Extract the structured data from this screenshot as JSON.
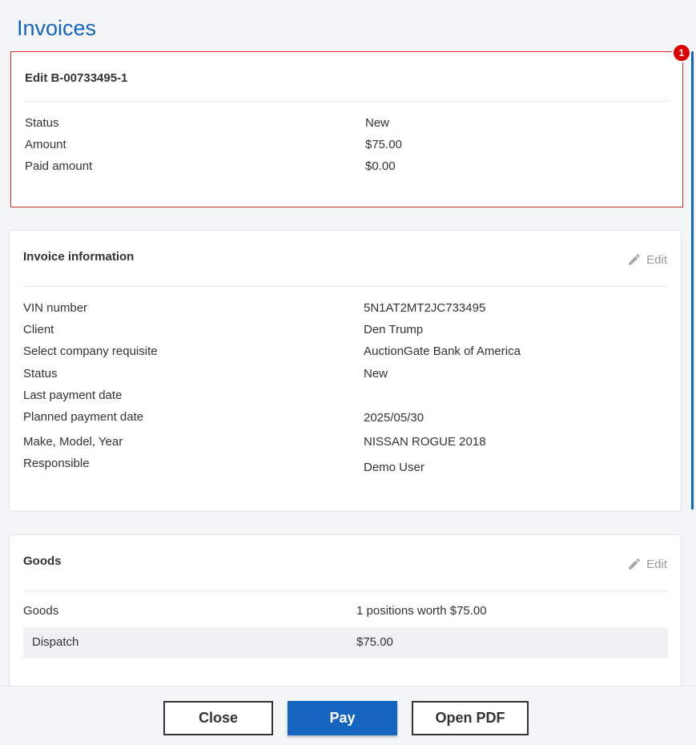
{
  "page": {
    "title": "Invoices"
  },
  "summary": {
    "title": "Edit B-00733495-1",
    "badge": "1",
    "rows": [
      {
        "label": "Status",
        "value": "New"
      },
      {
        "label": "Amount",
        "value": "$75.00"
      },
      {
        "label": "Paid amount",
        "value": "$0.00"
      }
    ]
  },
  "invoice_info": {
    "title": "Invoice information",
    "edit_label": "Edit",
    "rows": [
      {
        "label": "VIN number",
        "value": "5N1AT2MT2JC733495"
      },
      {
        "label": "Client",
        "value": "Den Trump"
      },
      {
        "label": "Select company requisite",
        "value": "AuctionGate Bank of America"
      },
      {
        "label": "Status",
        "value": "New"
      },
      {
        "label": "Last payment date",
        "value": ""
      },
      {
        "label": "Planned payment date",
        "value": "2025/05/30"
      },
      {
        "label": "Make, Model, Year",
        "value": "NISSAN ROGUE 2018"
      },
      {
        "label": "Responsible",
        "value": "Demo User"
      }
    ]
  },
  "goods": {
    "title": "Goods",
    "edit_label": "Edit",
    "summary": {
      "label": "Goods",
      "value": "1 positions worth $75.00"
    },
    "items": [
      {
        "label": "Dispatch",
        "value": "$75.00"
      }
    ]
  },
  "footer": {
    "close_label": "Close",
    "pay_label": "Pay",
    "pdf_label": "Open PDF"
  },
  "colors": {
    "accent": "#1565c0",
    "highlight": "#d32f2f",
    "badge": "#e00000"
  }
}
